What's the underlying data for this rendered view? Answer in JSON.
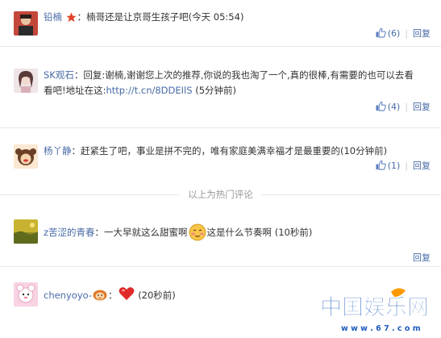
{
  "comments": [
    {
      "user": "铅楠",
      "text": "楠哥还是让京哥生孩子吧",
      "time": "(今天 05:54)",
      "likes": "(6)",
      "reply": "回复"
    },
    {
      "user": "SK观石",
      "text_part1": "回复:谢楠,谢谢您上次的推荐,你说的我也淘了一个,真的很棒,有需要的也可以去看",
      "text_part2": "看吧!地址在这:",
      "link": "http://t.cn/8DDEIlS",
      "time": "(5分钟前)",
      "likes": "(4)",
      "reply": "回复"
    },
    {
      "user": "杨丫静",
      "text": "赶紧生了吧，事业是拼不完的，唯有家庭美满幸福才是最重要的",
      "time": "(10分钟前)",
      "likes": "(1)",
      "reply": "回复"
    },
    {
      "user": "z苦涩的青春",
      "text_part1": "一大早就这么甜蜜啊",
      "text_part2": "这是什么节奏啊",
      "time": "(10秒前)",
      "reply": "回复"
    },
    {
      "user": "chenyoyo-",
      "time": "(20秒前)"
    }
  ],
  "hot_divider": "以上为热门评论",
  "watermark": {
    "brand": "中国娱乐网",
    "url": "w w w . 6 7 . c o m"
  },
  "colors": {
    "link": "#476aa6",
    "divider": "#e8e8e8",
    "logo_blue": "#1e5bbd",
    "logo_orange": "#ff9900"
  }
}
